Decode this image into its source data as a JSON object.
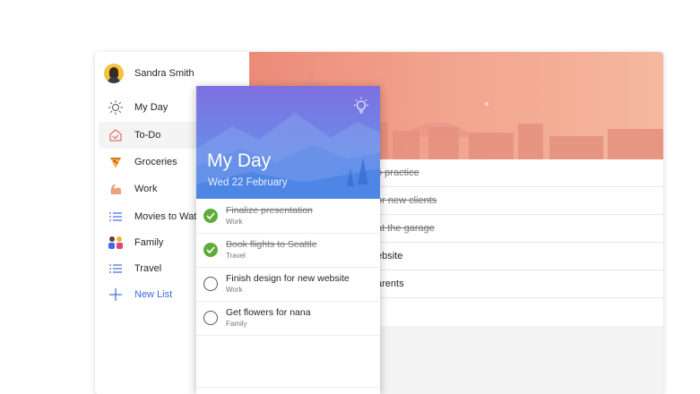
{
  "profile": {
    "name": "Sandra Smith"
  },
  "sidebar": {
    "items": [
      {
        "label": "My Day",
        "icon": "sun-icon"
      },
      {
        "label": "To-Do",
        "icon": "home-icon"
      },
      {
        "label": "Groceries",
        "icon": "pizza-icon"
      },
      {
        "label": "Work",
        "icon": "flexed-arm-icon"
      },
      {
        "label": "Movies to Wat",
        "icon": "list-icon"
      },
      {
        "label": "Family",
        "icon": "family-icon"
      },
      {
        "label": "Travel",
        "icon": "list-icon"
      },
      {
        "label": "New List",
        "icon": "plus-icon"
      }
    ]
  },
  "background_tasks": [
    {
      "text": "o practice",
      "done": true
    },
    {
      "text": "or new clients",
      "done": true
    },
    {
      "text": "at the garage",
      "done": true
    },
    {
      "text": "ebsite",
      "done": false
    },
    {
      "text": "arents",
      "done": false
    }
  ],
  "myday": {
    "title": "My Day",
    "date": "Wed 22 February",
    "tasks": [
      {
        "title": "Finalize presentation",
        "list": "Work",
        "done": true
      },
      {
        "title": "Book flights to Seattle",
        "list": "Travel",
        "done": true
      },
      {
        "title": "Finish design for new website",
        "list": "Work",
        "done": false
      },
      {
        "title": "Get flowers for nana",
        "list": "Family",
        "done": false
      }
    ]
  },
  "colors": {
    "accent_blue": "#3e69e4",
    "check_green": "#5fac3c",
    "hero_salmon": "#ec8b78",
    "panel_purple": "#7f6fe0"
  }
}
